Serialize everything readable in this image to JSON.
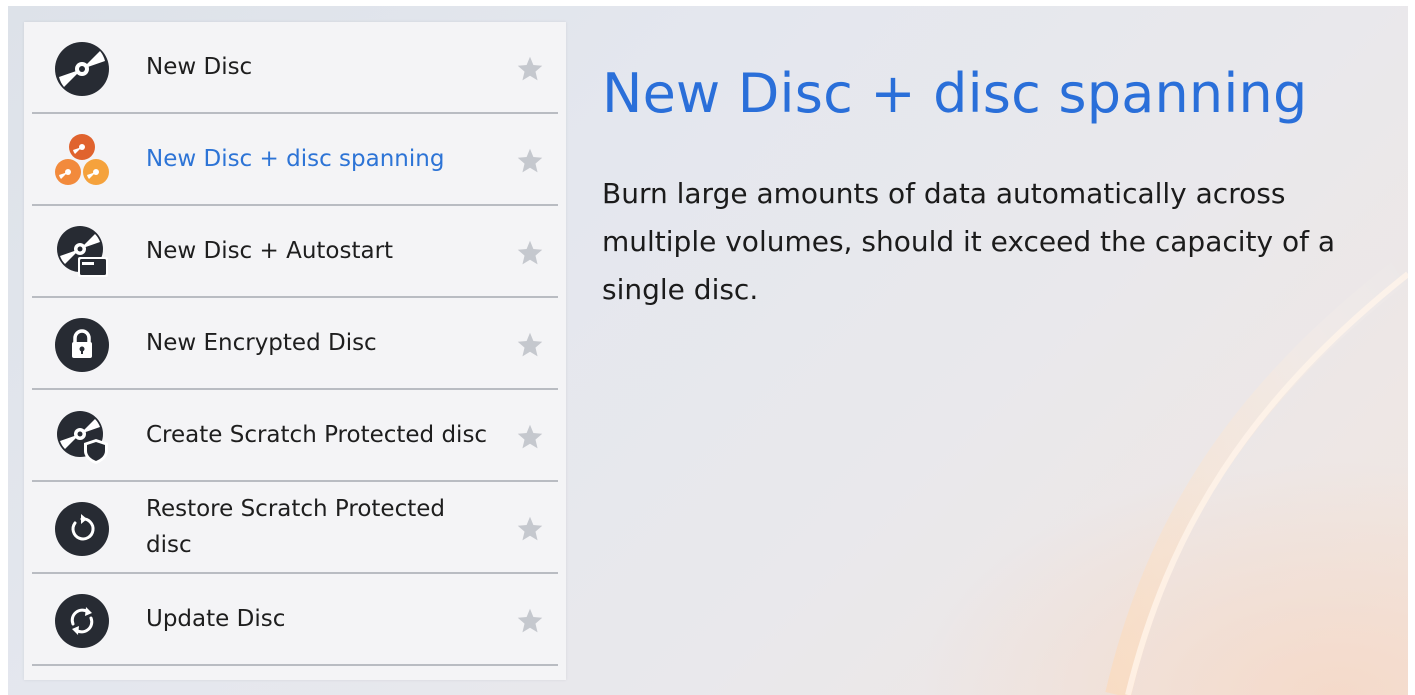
{
  "menu": {
    "items": [
      {
        "label": "New Disc",
        "icon": "disc-icon",
        "starred": false
      },
      {
        "label": "New Disc + disc spanning",
        "icon": "multi-disc-icon",
        "starred": false,
        "active": true
      },
      {
        "label": "New Disc + Autostart",
        "icon": "disc-autostart-icon",
        "starred": false
      },
      {
        "label": "New Encrypted Disc",
        "icon": "lock-icon",
        "starred": false
      },
      {
        "label": "Create Scratch Protected disc",
        "icon": "disc-shield-icon",
        "starred": false
      },
      {
        "label": "Restore Scratch Protected disc",
        "icon": "restore-icon",
        "starred": false
      },
      {
        "label": "Update Disc",
        "icon": "refresh-icon",
        "starred": false
      }
    ]
  },
  "detail": {
    "title": "New Disc + disc spanning",
    "description": "Burn large amounts of data automatically across multiple volumes, should it exceed the capacity of a single disc."
  },
  "colors": {
    "accent": "#2a6fd9",
    "icon_dark": "#272b33",
    "spanning_orange": "#ee7a3a",
    "star": "#c5c8ce"
  }
}
